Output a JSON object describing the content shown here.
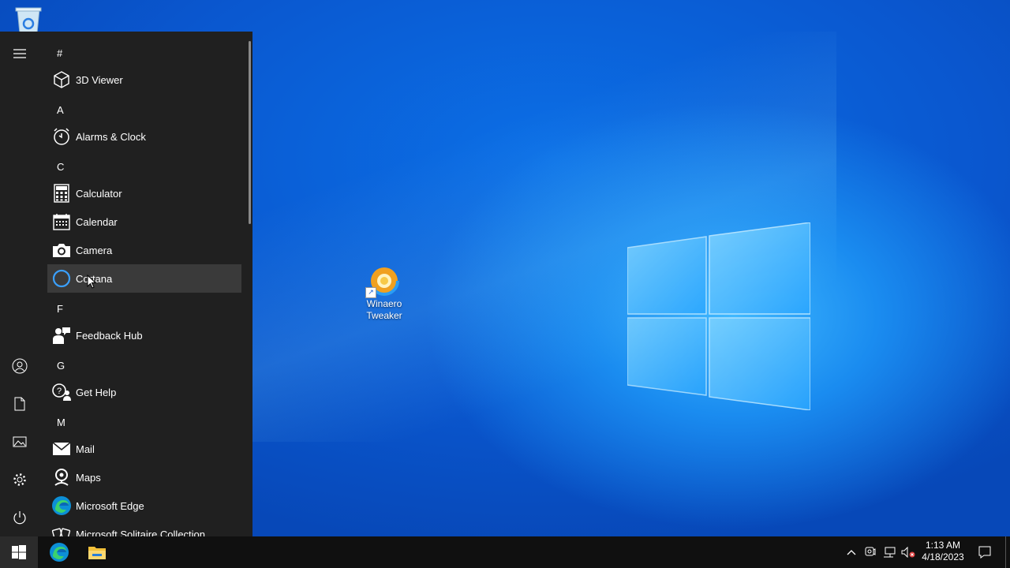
{
  "desktop": {
    "icons": [
      {
        "label_line1": "Winaero",
        "label_line2": "Tweaker",
        "icon": "winaero-tweaker-icon"
      }
    ],
    "recycle_bin_icon": "recycle-bin-icon"
  },
  "start_menu": {
    "rail": {
      "menu_icon": "hamburger-icon",
      "user_icon": "user-icon",
      "documents_icon": "document-icon",
      "pictures_icon": "pictures-icon",
      "settings_icon": "gear-icon",
      "power_icon": "power-icon"
    },
    "sections": [
      {
        "letter": "#",
        "apps": [
          {
            "label": "3D Viewer",
            "icon": "cube-icon"
          }
        ]
      },
      {
        "letter": "A",
        "apps": [
          {
            "label": "Alarms & Clock",
            "icon": "alarm-clock-icon"
          }
        ]
      },
      {
        "letter": "C",
        "apps": [
          {
            "label": "Calculator",
            "icon": "calculator-icon"
          },
          {
            "label": "Calendar",
            "icon": "calendar-icon"
          },
          {
            "label": "Camera",
            "icon": "camera-icon"
          },
          {
            "label": "Cortana",
            "icon": "cortana-icon",
            "hovered": true
          }
        ]
      },
      {
        "letter": "F",
        "apps": [
          {
            "label": "Feedback Hub",
            "icon": "feedback-icon"
          }
        ]
      },
      {
        "letter": "G",
        "apps": [
          {
            "label": "Get Help",
            "icon": "help-icon"
          }
        ]
      },
      {
        "letter": "M",
        "apps": [
          {
            "label": "Mail",
            "icon": "mail-icon"
          },
          {
            "label": "Maps",
            "icon": "maps-icon"
          },
          {
            "label": "Microsoft Edge",
            "icon": "edge-icon"
          },
          {
            "label": "Microsoft Solitaire Collection",
            "icon": "solitaire-icon"
          }
        ]
      }
    ]
  },
  "taskbar": {
    "start_icon": "windows-logo-icon",
    "pinned": [
      "edge-icon",
      "file-explorer-icon"
    ],
    "tray": [
      "chevron-up-icon",
      "meet-now-icon",
      "network-icon",
      "volume-muted-icon"
    ],
    "time": "1:13 AM",
    "date": "4/18/2023",
    "notification_icon": "action-center-icon"
  },
  "colors": {
    "desktop_blue": "#0a5ed8",
    "start_bg": "#202020",
    "taskbar_bg": "#101010"
  }
}
